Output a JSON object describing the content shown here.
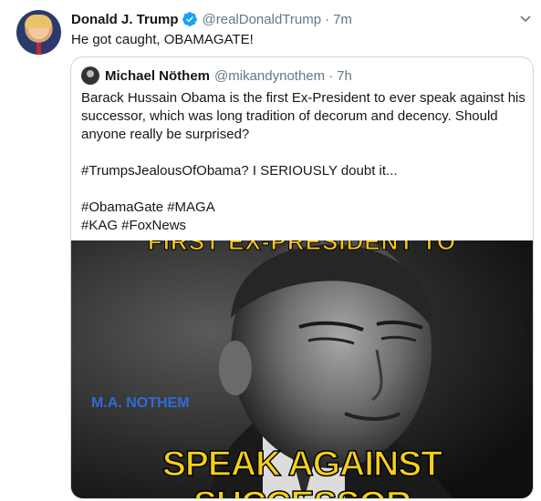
{
  "tweet": {
    "author_name": "Donald J. Trump",
    "verified": true,
    "handle": "@realDonaldTrump",
    "separator": "·",
    "time": "7m",
    "text": "He got caught, OBAMAGATE!",
    "avatar_icon": "profile-photo",
    "menu_icon": "chevron-down-icon",
    "accent_color": "#1da1f2"
  },
  "quoted_tweet": {
    "author_name": "Michael Nöthem",
    "handle": "@mikandynothem",
    "separator": "·",
    "time": "7h",
    "paragraphs": [
      "Barack Hussain Obama is the first Ex-President to ever speak against his successor, which was long tradition of decorum and decency. Should anyone really be surprised?",
      "#TrumpsJealousOfObama? I SERIOUSLY doubt it...",
      "#ObamaGate #MAGA",
      "#KAG #FoxNews"
    ],
    "media": {
      "top_banner_text": "FIRST EX-PRESIDENT TO",
      "watermark_text": "M.A. NOTHEM",
      "bottom_banner_text": "SPEAK AGAINST SUCCESSOR",
      "banner_color": "#f5cf1a",
      "watermark_color": "#2f6bd6"
    }
  }
}
